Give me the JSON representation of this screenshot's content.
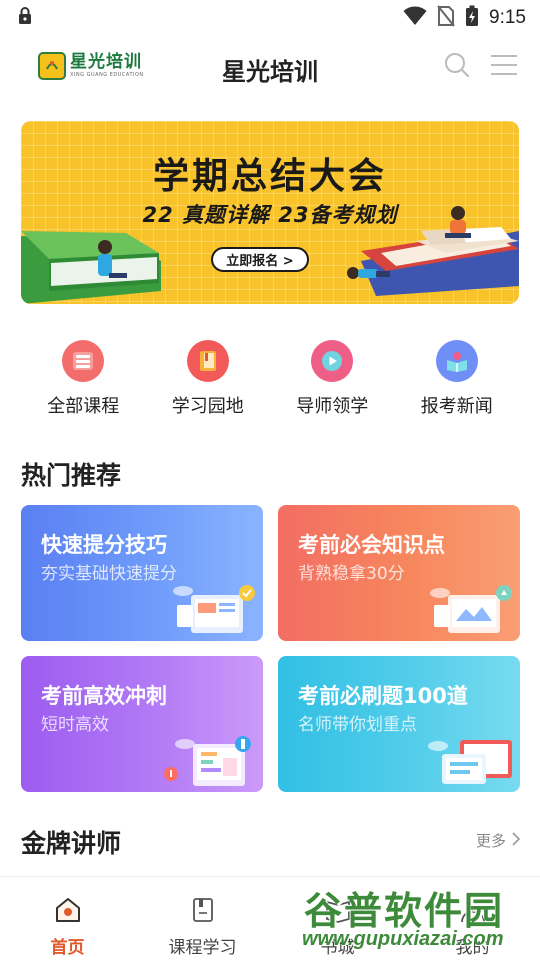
{
  "status_bar": {
    "time": "9:15",
    "icons": [
      "lock-icon",
      "wifi-icon",
      "no-sim-icon",
      "battery-charging-icon"
    ]
  },
  "header": {
    "brand_name": "星光培训",
    "brand_sub": "XING GUANG EDUCATION",
    "title": "星光培训",
    "icons": [
      "search-icon",
      "menu-icon"
    ]
  },
  "banner": {
    "title": "学期总结大会",
    "subtitle": "22 真题详解  23备考规划",
    "button_label": "立即报名 >",
    "bg_color": "#f8c22a"
  },
  "quick_nav": [
    {
      "label": "全部课程",
      "icon": "course-list-icon",
      "color": "#f26d6b"
    },
    {
      "label": "学习园地",
      "icon": "book-icon",
      "color": "#f25a5a"
    },
    {
      "label": "导师领学",
      "icon": "play-icon",
      "color": "#ef5e86"
    },
    {
      "label": "报考新闻",
      "icon": "news-book-icon",
      "color": "#6f8ff6"
    }
  ],
  "sections": {
    "hot": "热门推荐",
    "teachers": "金牌讲师",
    "more": "更多"
  },
  "cards": [
    {
      "title": "快速提分技巧",
      "subtitle": "夯实基础快速提分"
    },
    {
      "title": "考前必会知识点",
      "subtitle": "背熟稳拿30分"
    },
    {
      "title": "考前高效冲刺",
      "subtitle": "短时高效"
    },
    {
      "title": "考前必刷题100道",
      "subtitle": "名师带你划重点"
    }
  ],
  "bottom_nav": [
    {
      "label": "首页",
      "icon": "home-icon",
      "active": true
    },
    {
      "label": "课程学习",
      "icon": "course-doc-icon",
      "active": false
    },
    {
      "label": "书城",
      "icon": "bookstore-icon",
      "active": false
    },
    {
      "label": "我的",
      "icon": "profile-icon",
      "active": false
    }
  ],
  "watermark": {
    "title": "谷普软件园",
    "url": "www.gupuxiazai.com"
  },
  "colors": {
    "accent": "#e25a2c",
    "brand_green": "#1d7a3e"
  }
}
